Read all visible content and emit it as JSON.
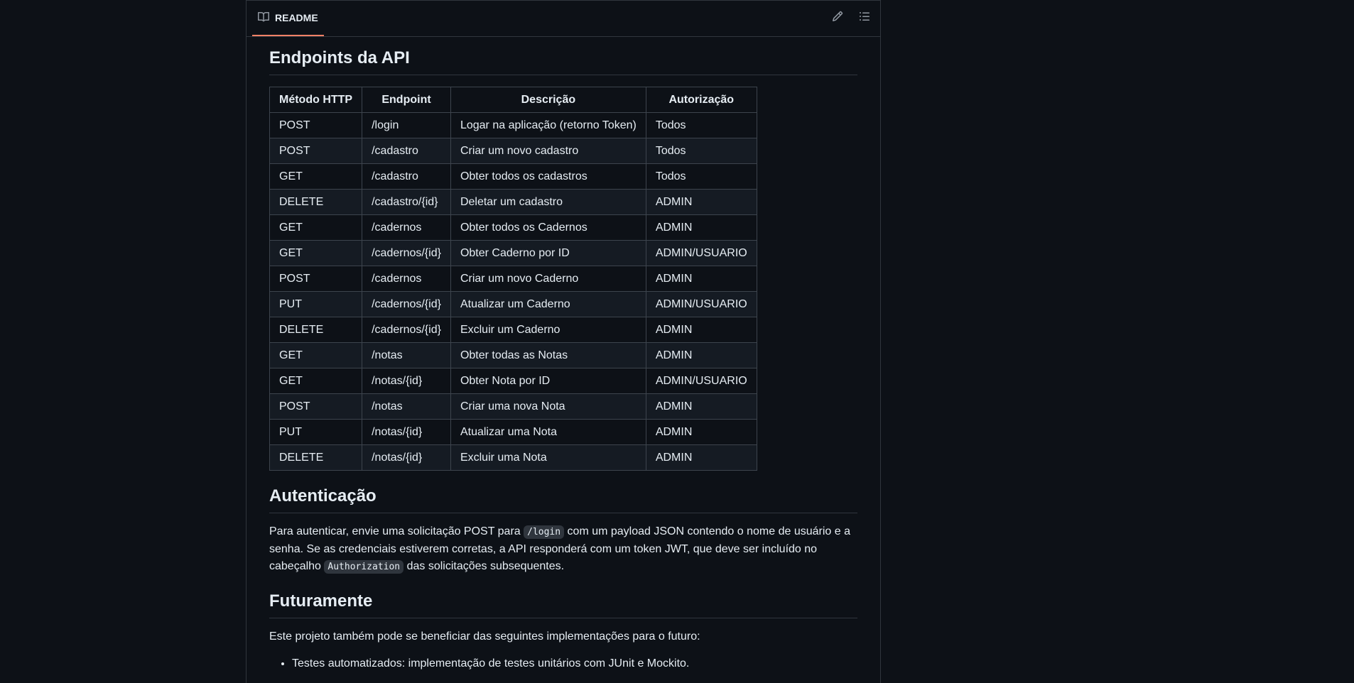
{
  "tab": {
    "label": "README"
  },
  "headings": {
    "endpoints": "Endpoints da API",
    "auth": "Autenticação",
    "future": "Futuramente"
  },
  "table": {
    "headers": [
      "Método HTTP",
      "Endpoint",
      "Descrição",
      "Autorização"
    ],
    "rows": [
      [
        "POST",
        "/login",
        "Logar na aplicação (retorno Token)",
        "Todos"
      ],
      [
        "POST",
        "/cadastro",
        "Criar um novo cadastro",
        "Todos"
      ],
      [
        "GET",
        "/cadastro",
        "Obter todos os cadastros",
        "Todos"
      ],
      [
        "DELETE",
        "/cadastro/{id}",
        "Deletar um cadastro",
        "ADMIN"
      ],
      [
        "GET",
        "/cadernos",
        "Obter todos os Cadernos",
        "ADMIN"
      ],
      [
        "GET",
        "/cadernos/{id}",
        "Obter Caderno por ID",
        "ADMIN/USUARIO"
      ],
      [
        "POST",
        "/cadernos",
        "Criar um novo Caderno",
        "ADMIN"
      ],
      [
        "PUT",
        "/cadernos/{id}",
        "Atualizar um Caderno",
        "ADMIN/USUARIO"
      ],
      [
        "DELETE",
        "/cadernos/{id}",
        "Excluir um Caderno",
        "ADMIN"
      ],
      [
        "GET",
        "/notas",
        "Obter todas as Notas",
        "ADMIN"
      ],
      [
        "GET",
        "/notas/{id}",
        "Obter Nota por ID",
        "ADMIN/USUARIO"
      ],
      [
        "POST",
        "/notas",
        "Criar uma nova Nota",
        "ADMIN"
      ],
      [
        "PUT",
        "/notas/{id}",
        "Atualizar uma Nota",
        "ADMIN"
      ],
      [
        "DELETE",
        "/notas/{id}",
        "Excluir uma Nota",
        "ADMIN"
      ]
    ]
  },
  "auth_paragraph": {
    "part1": "Para autenticar, envie uma solicitação POST para ",
    "code1": "/login",
    "part2": " com um payload JSON contendo o nome de usuário e a senha. Se as credenciais estiverem corretas, a API responderá com um token JWT, que deve ser incluído no cabeçalho ",
    "code2": "Authorization",
    "part3": " das solicitações subsequentes."
  },
  "future_paragraph": "Este projeto também pode se beneficiar das seguintes implementações para o futuro:",
  "future_items": [
    "Testes automatizados: implementação de testes unitários com JUnit e Mockito."
  ],
  "colors": {
    "tab_underline": "#f78166",
    "background": "#0d1117",
    "border": "#30363d"
  },
  "icons": {
    "tab": "book-icon",
    "edit": "pencil-icon",
    "outline": "list-unordered-icon"
  }
}
